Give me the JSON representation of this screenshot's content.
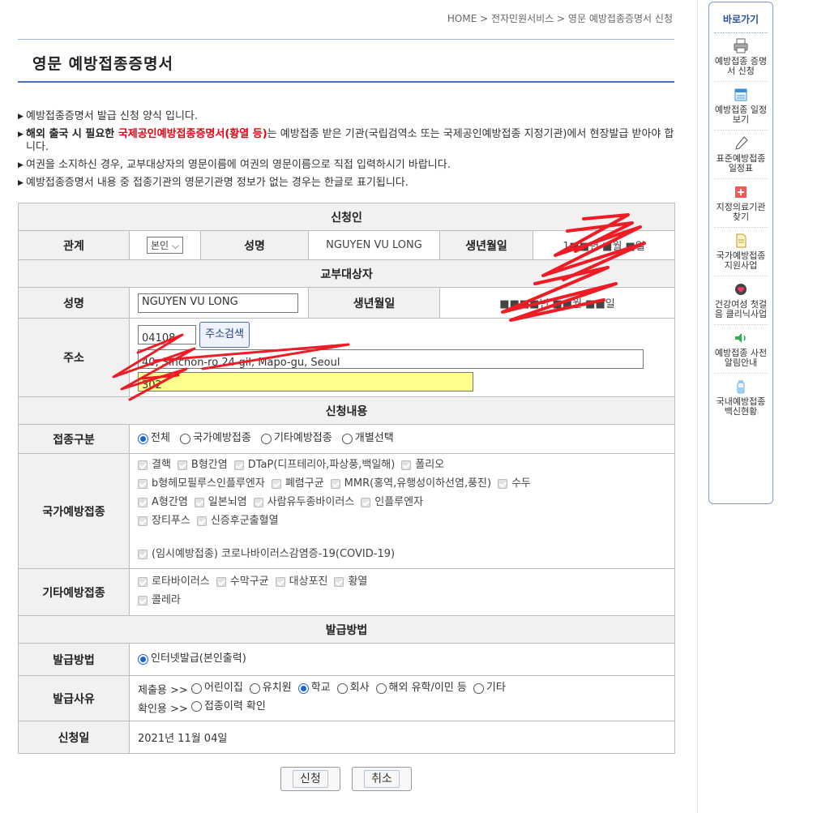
{
  "breadcrumb": "HOME > 전자민원서비스 > 영문 예방접종증명서 신청",
  "page_title": "영문 예방접종증명서",
  "notices": {
    "n1": "예방접종증명서 발급 신청 양식 입니다.",
    "n2_a": "해외 출국 시 필요한 ",
    "n2_b": "국제공인예방접종증명서(황열 등)",
    "n2_c": "는 예방접종 받은 기관(국립검역소 또는 국제공인예방접종 지정기관)에서 현장발급 받아야 합니다.",
    "n3": "여권을 소지하신 경우, 교부대상자의 영문이름에 여권의 영문이름으로 직접 입력하시기 바랍니다.",
    "n4": "예방접종증명서 내용 중 접종기관의 영문기관명 정보가 없는 경우는 한글로 표기됩니다."
  },
  "applicant": {
    "section": "신청인",
    "relation_label": "관계",
    "relation_value": "본인",
    "name_label": "성명",
    "name_value": "NGUYEN VU LONG",
    "dob_label": "생년월일",
    "dob_value": "1■■년 ■월 ■일"
  },
  "recipient": {
    "section": "교부대상자",
    "name_label": "성명",
    "name_value": "NGUYEN VU LONG",
    "dob_label": "생년월일",
    "dob_value": "■■■■년 ■■월 ■■일",
    "address_label": "주소",
    "postcode": "04108",
    "address_search": "주소검색",
    "address1": "40, Sinchon-ro 24-gil, Mapo-gu, Seoul",
    "address2": "302"
  },
  "request": {
    "section": "신청내용",
    "type_label": "접종구분",
    "type_options": [
      "전체",
      "국가예방접종",
      "기타예방접종",
      "개별선택"
    ],
    "type_selected": "전체",
    "national_label": "국가예방접종",
    "national_rows": [
      [
        "결핵",
        "B형간염",
        "DTaP(디프테리아,파상풍,백일해)",
        "폴리오"
      ],
      [
        "b형헤모필루스인플루엔자",
        "폐렴구균",
        "MMR(홍역,유행성이하선염,풍진)",
        "수두"
      ],
      [
        "A형간염",
        "일본뇌염",
        "사람유두종바이러스",
        "인플루엔자"
      ],
      [
        "장티푸스",
        "신증후군출혈열"
      ]
    ],
    "national_covid": "(임시예방접종) 코로나바이러스감염증-19(COVID-19)",
    "other_label": "기타예방접종",
    "other_rows": [
      [
        "로타바이러스",
        "수막구균",
        "대상포진",
        "황열"
      ],
      [
        "콜레라"
      ]
    ]
  },
  "issue": {
    "section": "발급방법",
    "method_label": "발급방법",
    "method_value": "인터넷발급(본인출력)",
    "reason_label": "발급사유",
    "reason_prefix1": "제출용 >>",
    "reason_options": [
      "어린이집",
      "유치원",
      "학교",
      "회사",
      "해외 유학/이민 등",
      "기타"
    ],
    "reason_selected": "학교",
    "reason_prefix2": "확인용 >>",
    "reason_option2": "접종이력 확인",
    "date_label": "신청일",
    "date_value": "2021년 11월 04일"
  },
  "buttons": {
    "submit": "신청",
    "cancel": "취소"
  },
  "quick": {
    "title": "바로가기",
    "items": [
      {
        "label": "예방접종 증명서 신청",
        "icon": "printer-icon"
      },
      {
        "label": "예방접종 일정보기",
        "icon": "calendar-icon"
      },
      {
        "label": "표준예방접종 일정표",
        "icon": "pen-icon"
      },
      {
        "label": "지정의료기관 찾기",
        "icon": "hospital-icon"
      },
      {
        "label": "국가예방접종 지원사업",
        "icon": "document-icon"
      },
      {
        "label": "건강여성 첫걸음 클리닉사업",
        "icon": "heart-icon"
      },
      {
        "label": "예방접종 사전알림안내",
        "icon": "speaker-icon"
      },
      {
        "label": "국내예방접종 백신현황",
        "icon": "vaccine-icon"
      }
    ]
  },
  "colors": {
    "accent": "#4a72b7",
    "red": "#e60012",
    "radio": "#1d63d6",
    "highlight": "#ffff8c",
    "scribble": "#ee1c25"
  }
}
